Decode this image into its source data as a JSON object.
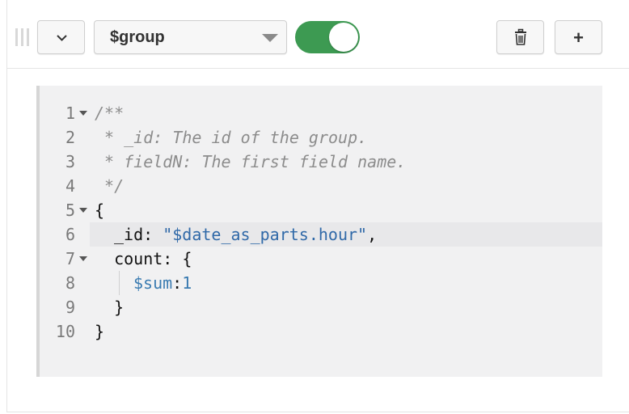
{
  "toolbar": {
    "stage_operator": "$group",
    "add_label": "+",
    "toggle_enabled": true
  },
  "editor": {
    "lines": [
      {
        "num": "1",
        "text": "/**"
      },
      {
        "num": "2",
        "text": " * _id: The id of the group."
      },
      {
        "num": "3",
        "text": " * fieldN: The first field name."
      },
      {
        "num": "4",
        "text": " */"
      },
      {
        "num": "5",
        "text": "{"
      },
      {
        "num": "6",
        "key": "_id: ",
        "value": "\"$date_as_parts.hour\"",
        "suffix": ","
      },
      {
        "num": "7",
        "text": "  count: {"
      },
      {
        "num": "8",
        "key": "$sum",
        "sep": ":",
        "value": "1"
      },
      {
        "num": "9",
        "text": "  }"
      },
      {
        "num": "10",
        "text": "}"
      }
    ]
  },
  "colors": {
    "toggle": "#3d9a52",
    "editor_bg": "#f1f1f2",
    "comment": "#8c8c8c",
    "string": "#3069a8"
  }
}
